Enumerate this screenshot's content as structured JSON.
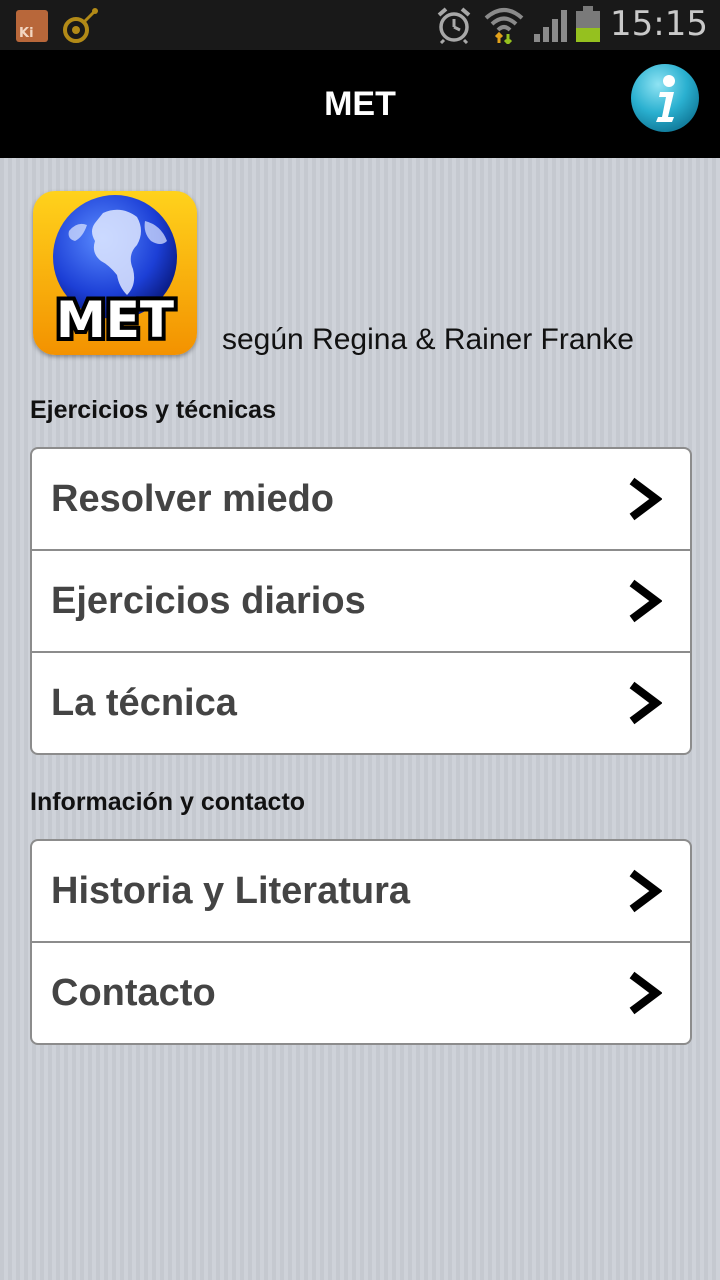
{
  "status_bar": {
    "time": "15:15",
    "battery_level": 0.45,
    "left_icons": [
      "kies-icon",
      "satellite-icon"
    ],
    "right_icons": [
      "alarm-clock-icon",
      "wifi-icon",
      "signal-icon",
      "battery-icon"
    ],
    "kies_text": "Ki"
  },
  "header": {
    "title": "MET",
    "info_icon": "info-icon",
    "info_color": "#2ab0d0"
  },
  "intro": {
    "logo_text": "MET",
    "attribution": "según Regina & Rainer Franke"
  },
  "sections": [
    {
      "title": "Ejercicios y técnicas",
      "items": [
        {
          "label": "Resolver miedo",
          "icon": "chevron-right-icon"
        },
        {
          "label": "Ejercicios diarios",
          "icon": "chevron-right-icon"
        },
        {
          "label": "La técnica",
          "icon": "chevron-right-icon"
        }
      ]
    },
    {
      "title": "Información y contacto",
      "items": [
        {
          "label": "Historia y Literatura",
          "icon": "chevron-right-icon"
        },
        {
          "label": "Contacto",
          "icon": "chevron-right-icon"
        }
      ]
    }
  ],
  "colors": {
    "header_bg": "#000000",
    "page_bg": "#c8ccd3",
    "item_text": "#444444",
    "logo_bg": "#f5a10a",
    "globe_blue": "#1c3fd6"
  }
}
